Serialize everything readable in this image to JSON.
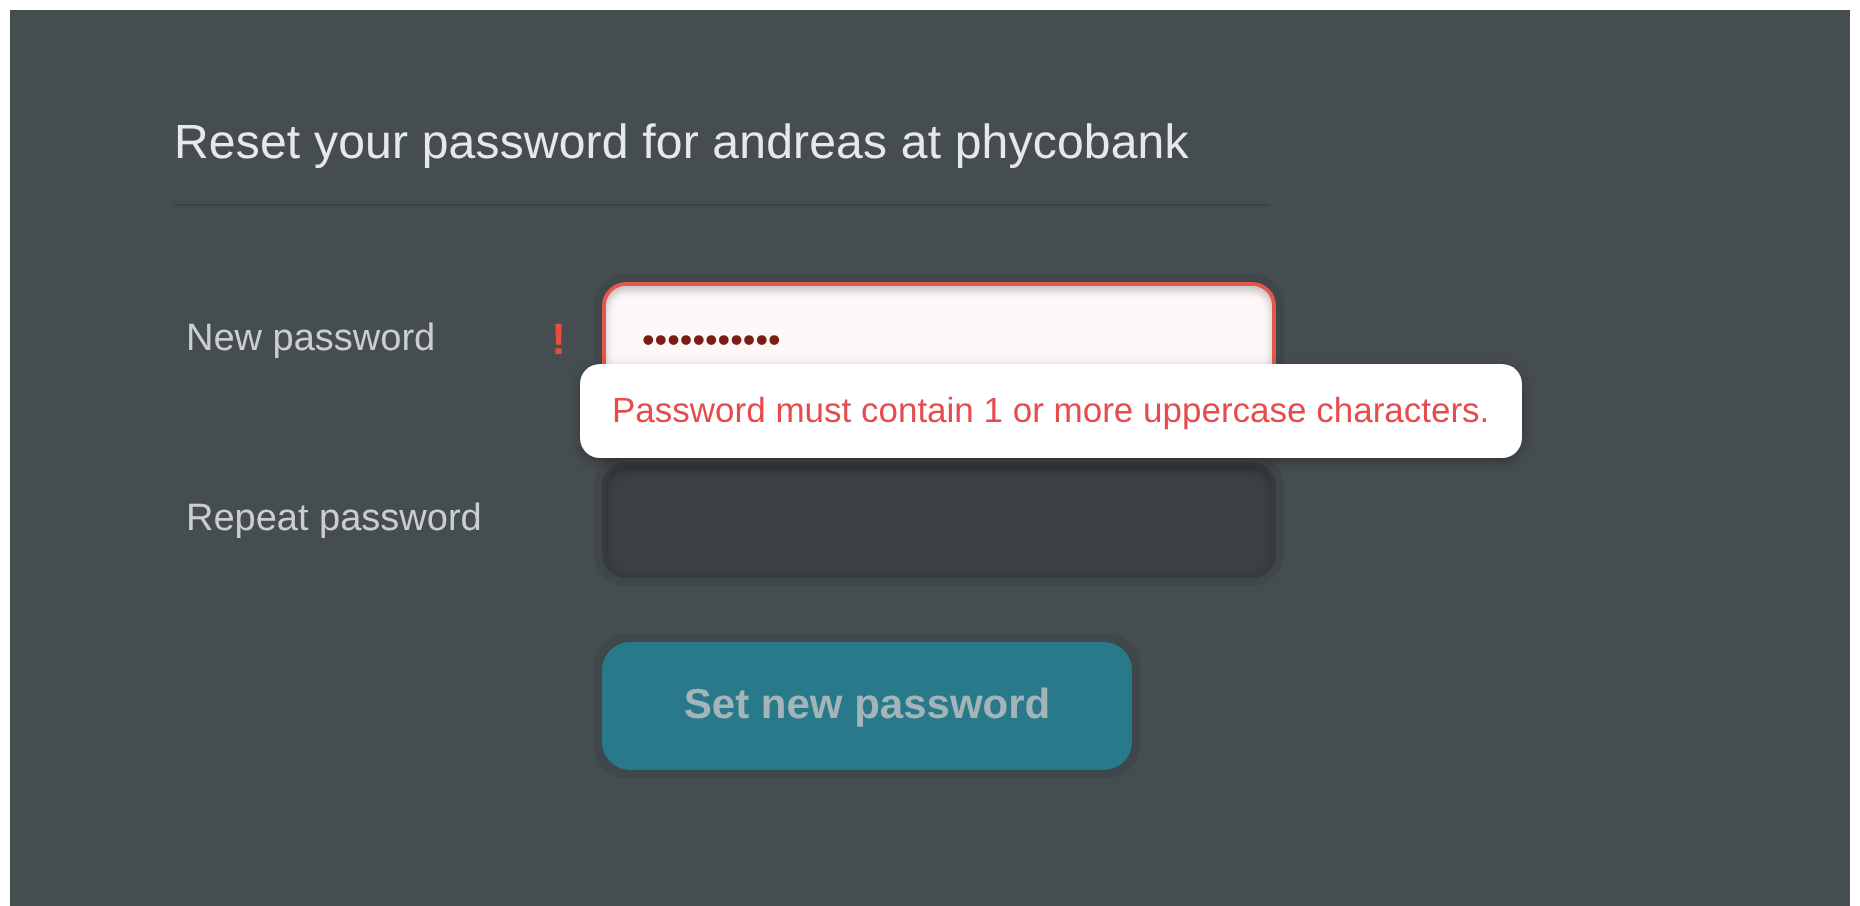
{
  "title": "Reset your password for andreas at phycobank",
  "fields": [
    {
      "label": "New password",
      "value": "•••••••••••",
      "invalid": true,
      "error_mark": "!",
      "error_message": "Password must contain 1 or more uppercase characters."
    },
    {
      "label": "Repeat password",
      "invalid": false
    }
  ],
  "submit": {
    "label": "Set new password",
    "disabled": true
  }
}
